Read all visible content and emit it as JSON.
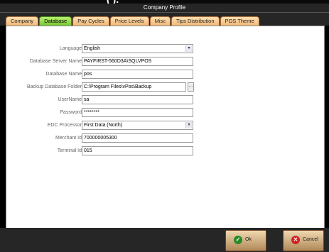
{
  "window": {
    "top_title": "(                                      ).",
    "title": "Company Profile"
  },
  "tabs": [
    {
      "label": "Company",
      "active": false
    },
    {
      "label": "Database",
      "active": true
    },
    {
      "label": "Pay Cycles",
      "active": false
    },
    {
      "label": "Price Levels",
      "active": false
    },
    {
      "label": "Misc",
      "active": false
    },
    {
      "label": "Tips Distribution",
      "active": false
    },
    {
      "label": "POS Theme",
      "active": false
    }
  ],
  "form": {
    "language": {
      "label": "Language",
      "value": "English"
    },
    "server": {
      "label": "Database Server Name",
      "value": "PAYFIRST-560D3A\\SQLVPOS"
    },
    "dbname": {
      "label": "Database Name",
      "value": "pos"
    },
    "backup": {
      "label": "Backup Database Folder",
      "value": "C:\\Program Files\\vPos\\Backup",
      "browse": "..."
    },
    "username": {
      "label": "UserName",
      "value": "sa"
    },
    "password": {
      "label": "Password",
      "value": "********"
    },
    "edc": {
      "label": "EDC Processor",
      "value": "First Data (North)"
    },
    "merchant": {
      "label": "Merchant Id",
      "value": "700000005300"
    },
    "terminal": {
      "label": "Terminal Id",
      "value": "015"
    }
  },
  "dropdown_glyph": "▾",
  "buttons": {
    "ok": {
      "label": "Ok",
      "icon": "check-icon",
      "glyph": "✓",
      "color": "#2a8a2a"
    },
    "cancel": {
      "label": "Cancel",
      "icon": "x-icon",
      "glyph": "✕",
      "color": "#d02020"
    }
  }
}
